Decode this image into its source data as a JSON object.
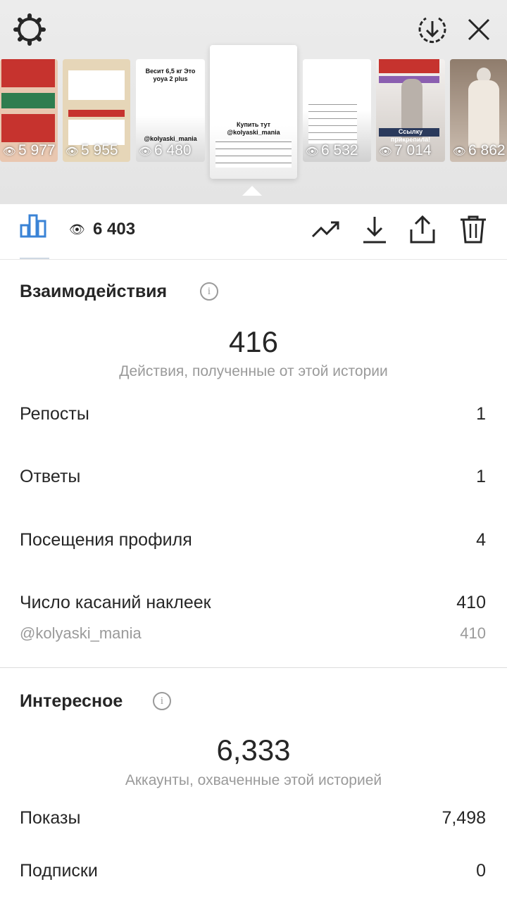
{
  "stories": [
    {
      "views": "5 977"
    },
    {
      "views": "5 955"
    },
    {
      "views": "6 480",
      "caption": "Весит 6,5 кг Это yoya 2 plus",
      "handle": "@kolyaski_mania"
    },
    {
      "caption": "Купить тут @kolyaski_mania"
    },
    {
      "views": "6 532"
    },
    {
      "views": "7 014",
      "caption": "Ссылку прикрепила!"
    },
    {
      "views": "6 862"
    }
  ],
  "toolbar": {
    "total_views": "6 403"
  },
  "interactions": {
    "title": "Взаимодействия",
    "total": "416",
    "subtitle": "Действия, полученные от этой истории",
    "rows": [
      {
        "label": "Репосты",
        "value": "1"
      },
      {
        "label": "Ответы",
        "value": "1"
      },
      {
        "label": "Посещения профиля",
        "value": "4"
      },
      {
        "label": "Число касаний наклеек",
        "value": "410"
      }
    ],
    "sticker": {
      "label": "@kolyaski_mania",
      "value": "410"
    }
  },
  "discovery": {
    "title": "Интересное",
    "total": "6,333",
    "subtitle": "Аккаунты, охваченные этой историей",
    "rows": [
      {
        "label": "Показы",
        "value": "7,498"
      },
      {
        "label": "Подписки",
        "value": "0"
      }
    ]
  },
  "colors": {
    "accent": "#3a83d6",
    "band_red": "#c6332e"
  },
  "icons": [
    "settings-icon",
    "download-circle-icon",
    "close-icon",
    "insights-bars-icon",
    "eye-icon",
    "trend-icon",
    "download-icon",
    "share-icon",
    "trash-icon",
    "info-icon"
  ]
}
